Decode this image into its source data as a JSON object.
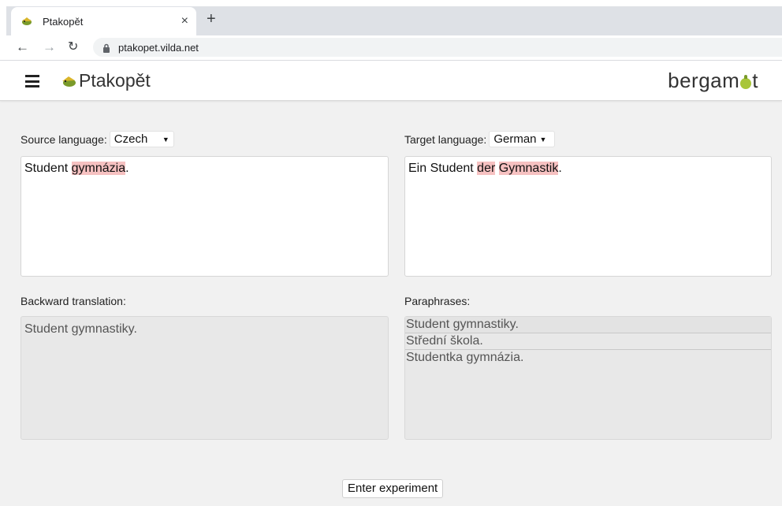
{
  "browser": {
    "tab_title": "Ptakopět",
    "tab_close": "×",
    "new_tab": "+",
    "url": "ptakopet.vilda.net"
  },
  "header": {
    "brand": "Ptakopět",
    "logo_right_prefix": "bergam",
    "logo_right_suffix": "t",
    "menu_icon": "hamburger-icon"
  },
  "source": {
    "label": "Source language:",
    "language": "Czech",
    "text_parts": [
      {
        "text": "Student ",
        "highlight": false
      },
      {
        "text": "gymnázia",
        "highlight": true
      },
      {
        "text": ".",
        "highlight": false
      }
    ]
  },
  "target": {
    "label": "Target language:",
    "language": "German",
    "text_parts": [
      {
        "text": "Ein Student ",
        "highlight": false
      },
      {
        "text": "der",
        "highlight": true
      },
      {
        "text": " ",
        "highlight": false
      },
      {
        "text": "Gymnastik",
        "highlight": true
      },
      {
        "text": ".",
        "highlight": false
      }
    ]
  },
  "backward": {
    "label": "Backward translation:",
    "text": "Student gymnastiky."
  },
  "paraphrases": {
    "label": "Paraphrases:",
    "items": [
      "Student gymnastiky.",
      "Střední škola.",
      "Studentka gymnázia."
    ]
  },
  "actions": {
    "enter_label": "Enter experiment"
  },
  "colors": {
    "highlight": "#f6c1c1",
    "bergamot_accent": "#a8c639"
  }
}
